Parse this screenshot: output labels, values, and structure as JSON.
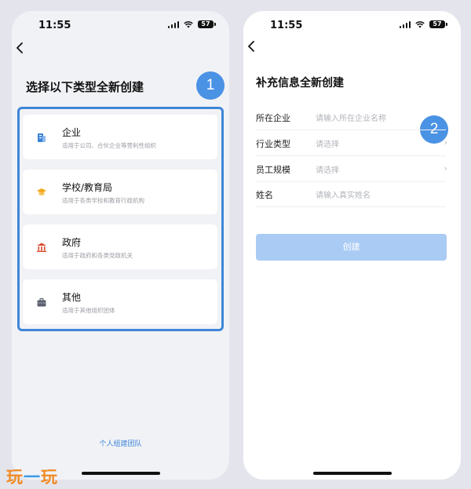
{
  "status_bar": {
    "time": "11:55",
    "battery": "57"
  },
  "left_screen": {
    "title": "选择以下类型全新创建",
    "step_badge": "1",
    "options": [
      {
        "title": "企业",
        "desc": "适用于公司、合伙企业等营利性组织",
        "icon": "building-icon",
        "color": "#3b82d6"
      },
      {
        "title": "学校/教育局",
        "desc": "适用于各类学校和教育行政机构",
        "icon": "graduation-cap-icon",
        "color": "#f2a81d"
      },
      {
        "title": "政府",
        "desc": "适用于政府和各类党政机关",
        "icon": "government-building-icon",
        "color": "#d9472b"
      },
      {
        "title": "其他",
        "desc": "适用于其他组织团体",
        "icon": "briefcase-icon",
        "color": "#5c6170"
      }
    ],
    "personal_team_link": "个人组建团队"
  },
  "right_screen": {
    "title": "补充信息全新创建",
    "step_badge": "2",
    "fields": [
      {
        "label": "所在企业",
        "placeholder": "请输入所在企业名称"
      },
      {
        "label": "行业类型",
        "placeholder": "请选择"
      },
      {
        "label": "员工规模",
        "placeholder": "请选择"
      },
      {
        "label": "姓名",
        "placeholder": "请输入真实姓名"
      }
    ],
    "create_button": "创建"
  },
  "watermark": [
    "玩",
    "一",
    "玩"
  ],
  "colors": {
    "accent": "#3e86d8",
    "badge": "#4a92e4",
    "button_disabled": "#aacbf4"
  }
}
